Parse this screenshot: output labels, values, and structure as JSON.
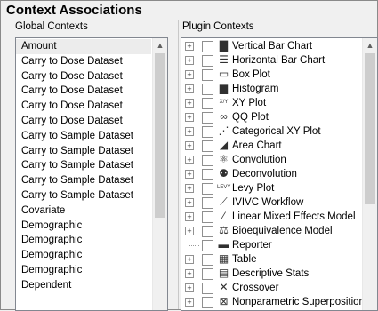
{
  "panel": {
    "title": "Context Associations"
  },
  "global": {
    "header": "Global Contexts",
    "items": [
      "Amount",
      "Carry to Dose Dataset",
      "Carry to Dose Dataset",
      "Carry to Dose Dataset",
      "Carry to Dose Dataset",
      "Carry to Dose Dataset",
      "Carry to Sample Dataset",
      "Carry to Sample Dataset",
      "Carry to Sample Dataset",
      "Carry to Sample Dataset",
      "Carry to Sample Dataset",
      "Covariate",
      "Demographic",
      "Demographic",
      "Demographic",
      "Demographic",
      "Dependent"
    ],
    "selected_index": 0
  },
  "plugin": {
    "header": "Plugin Contexts",
    "items": [
      {
        "label": "Vertical Bar Chart",
        "icon": "vertical-bar-chart-icon",
        "expandable": true
      },
      {
        "label": "Horizontal Bar Chart",
        "icon": "horizontal-bar-chart-icon",
        "expandable": true
      },
      {
        "label": "Box Plot",
        "icon": "box-plot-icon",
        "expandable": true
      },
      {
        "label": "Histogram",
        "icon": "histogram-icon",
        "expandable": true
      },
      {
        "label": "XY Plot",
        "icon": "xy-plot-icon",
        "expandable": true
      },
      {
        "label": "QQ Plot",
        "icon": "qq-plot-icon",
        "expandable": true
      },
      {
        "label": "Categorical XY Plot",
        "icon": "categorical-xy-plot-icon",
        "expandable": true
      },
      {
        "label": "Area Chart",
        "icon": "area-chart-icon",
        "expandable": true
      },
      {
        "label": "Convolution",
        "icon": "convolution-icon",
        "expandable": true
      },
      {
        "label": "Deconvolution",
        "icon": "deconvolution-icon",
        "expandable": true
      },
      {
        "label": "Levy Plot",
        "icon": "levy-plot-icon",
        "expandable": true
      },
      {
        "label": "IVIVC Workflow",
        "icon": "ivivc-workflow-icon",
        "expandable": true
      },
      {
        "label": "Linear Mixed Effects Model",
        "icon": "linear-mixed-effects-icon",
        "expandable": true
      },
      {
        "label": "Bioequivalence Model",
        "icon": "bioequivalence-icon",
        "expandable": true
      },
      {
        "label": "Reporter",
        "icon": "reporter-icon",
        "expandable": false
      },
      {
        "label": "Table",
        "icon": "table-icon",
        "expandable": true
      },
      {
        "label": "Descriptive Stats",
        "icon": "descriptive-stats-icon",
        "expandable": true
      },
      {
        "label": "Crossover",
        "icon": "crossover-icon",
        "expandable": true
      },
      {
        "label": "Nonparametric Superposition",
        "icon": "nonparametric-superposition-icon",
        "expandable": true
      }
    ]
  },
  "icon_glyphs": {
    "vertical-bar-chart-icon": "▇",
    "horizontal-bar-chart-icon": "☰",
    "box-plot-icon": "▭",
    "histogram-icon": "▆",
    "xy-plot-icon": "X/Y",
    "qq-plot-icon": "∞",
    "categorical-xy-plot-icon": "⋰",
    "area-chart-icon": "◢",
    "convolution-icon": "⚛",
    "deconvolution-icon": "⚉",
    "levy-plot-icon": "LEVY",
    "ivivc-workflow-icon": "⟋",
    "linear-mixed-effects-icon": "⁄",
    "bioequivalence-icon": "⚖",
    "reporter-icon": "▬",
    "table-icon": "▦",
    "descriptive-stats-icon": "▤",
    "crossover-icon": "✕",
    "nonparametric-superposition-icon": "⊠"
  }
}
